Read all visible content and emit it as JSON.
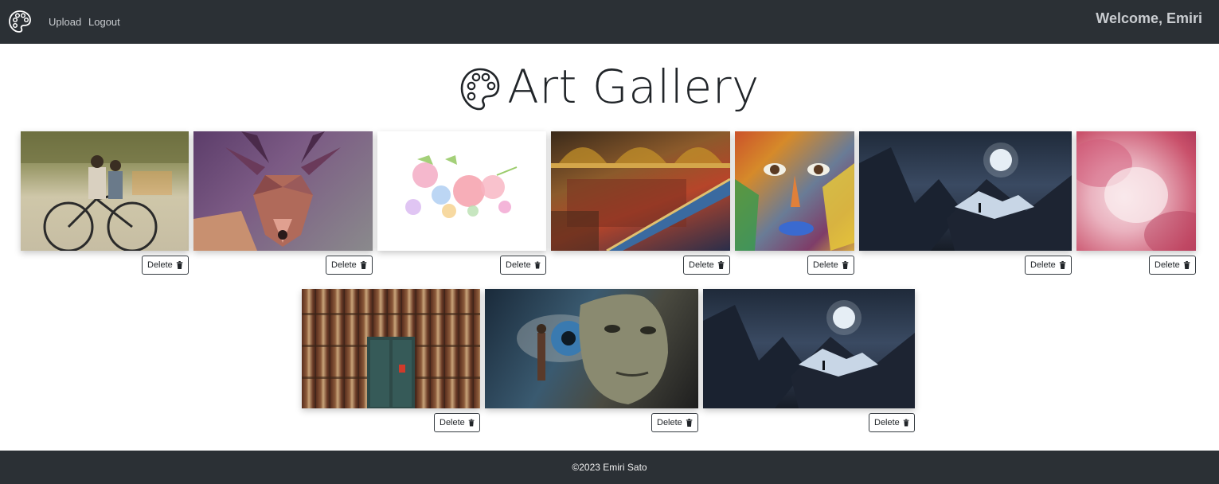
{
  "navbar": {
    "upload_label": "Upload",
    "logout_label": "Logout",
    "welcome_text": "Welcome, Emiri"
  },
  "page": {
    "title": "Art Gallery"
  },
  "gallery": {
    "delete_label": "Delete",
    "artworks": [
      {
        "subject": "children on bicycle wall mural",
        "delete_label": "Delete"
      },
      {
        "subject": "low-poly deer",
        "delete_label": "Delete"
      },
      {
        "subject": "watercolor flowers",
        "delete_label": "Delete"
      },
      {
        "subject": "ornate stained glass staircase painting",
        "delete_label": "Delete"
      },
      {
        "subject": "colorful painted face",
        "delete_label": "Delete"
      },
      {
        "subject": "moonlit mountains",
        "delete_label": "Delete"
      },
      {
        "subject": "pink abstract watercolor",
        "delete_label": "Delete"
      },
      {
        "subject": "wall of books with door",
        "delete_label": "Delete"
      },
      {
        "subject": "surreal eye and mask",
        "delete_label": "Delete"
      },
      {
        "subject": "moonlit mountains",
        "delete_label": "Delete"
      }
    ]
  },
  "footer": {
    "text": "©2023 Emiri Sato"
  },
  "colors": {
    "navbar_bg": "#2b3035",
    "nav_text": "#c9ccd0",
    "footer_bg": "#2b3035",
    "button_border": "#343a40"
  },
  "icons": {
    "brand": "palette-icon",
    "delete": "trash-icon"
  }
}
